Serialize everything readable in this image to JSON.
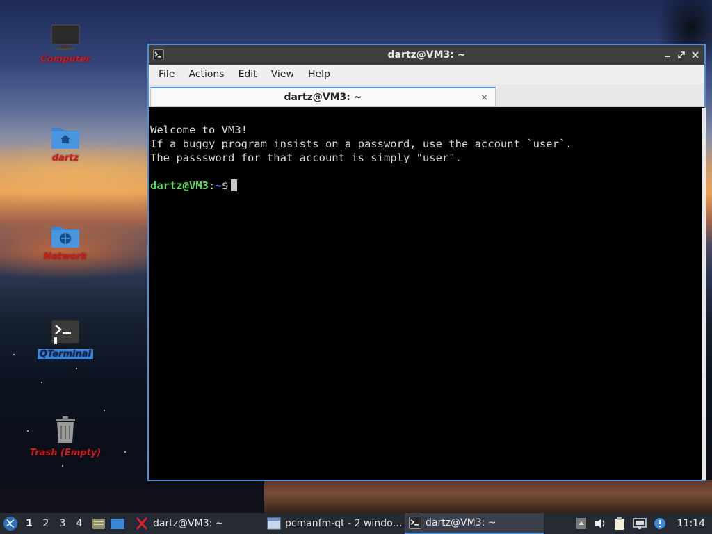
{
  "desktop": {
    "icons": [
      {
        "label": "Computer"
      },
      {
        "label": "dartz"
      },
      {
        "label": "Network"
      },
      {
        "label": "QTerminal"
      },
      {
        "label": "Trash (Empty)"
      }
    ]
  },
  "window": {
    "title": "dartz@VM3: ~",
    "menu": [
      "File",
      "Actions",
      "Edit",
      "View",
      "Help"
    ],
    "tab": {
      "label": "dartz@VM3: ~",
      "close": "×"
    },
    "terminal": {
      "lines": [
        "Welcome to VM3!",
        "If a buggy program insists on a password, use the account `user`.",
        "The passsword for that account is simply \"user\"."
      ],
      "prompt_user": "dartz@VM3",
      "prompt_sep": ":",
      "prompt_path": "~",
      "prompt_symbol": "$"
    }
  },
  "taskbar": {
    "desktops": [
      "1",
      "2",
      "3",
      "4"
    ],
    "active_desktop": "1",
    "tasks": [
      {
        "label": "dartz@VM3: ~",
        "icon": "x-icon"
      },
      {
        "label": "pcmanfm-qt - 2 windo…",
        "icon": "window-icon"
      },
      {
        "label": "dartz@VM3: ~",
        "icon": "terminal-icon"
      }
    ],
    "clock": "11:14"
  },
  "colors": {
    "accent": "#4a8fd8",
    "desktop_label": "#d11a1a",
    "prompt_user": "#5fd75f",
    "prompt_path": "#5f87ff"
  }
}
